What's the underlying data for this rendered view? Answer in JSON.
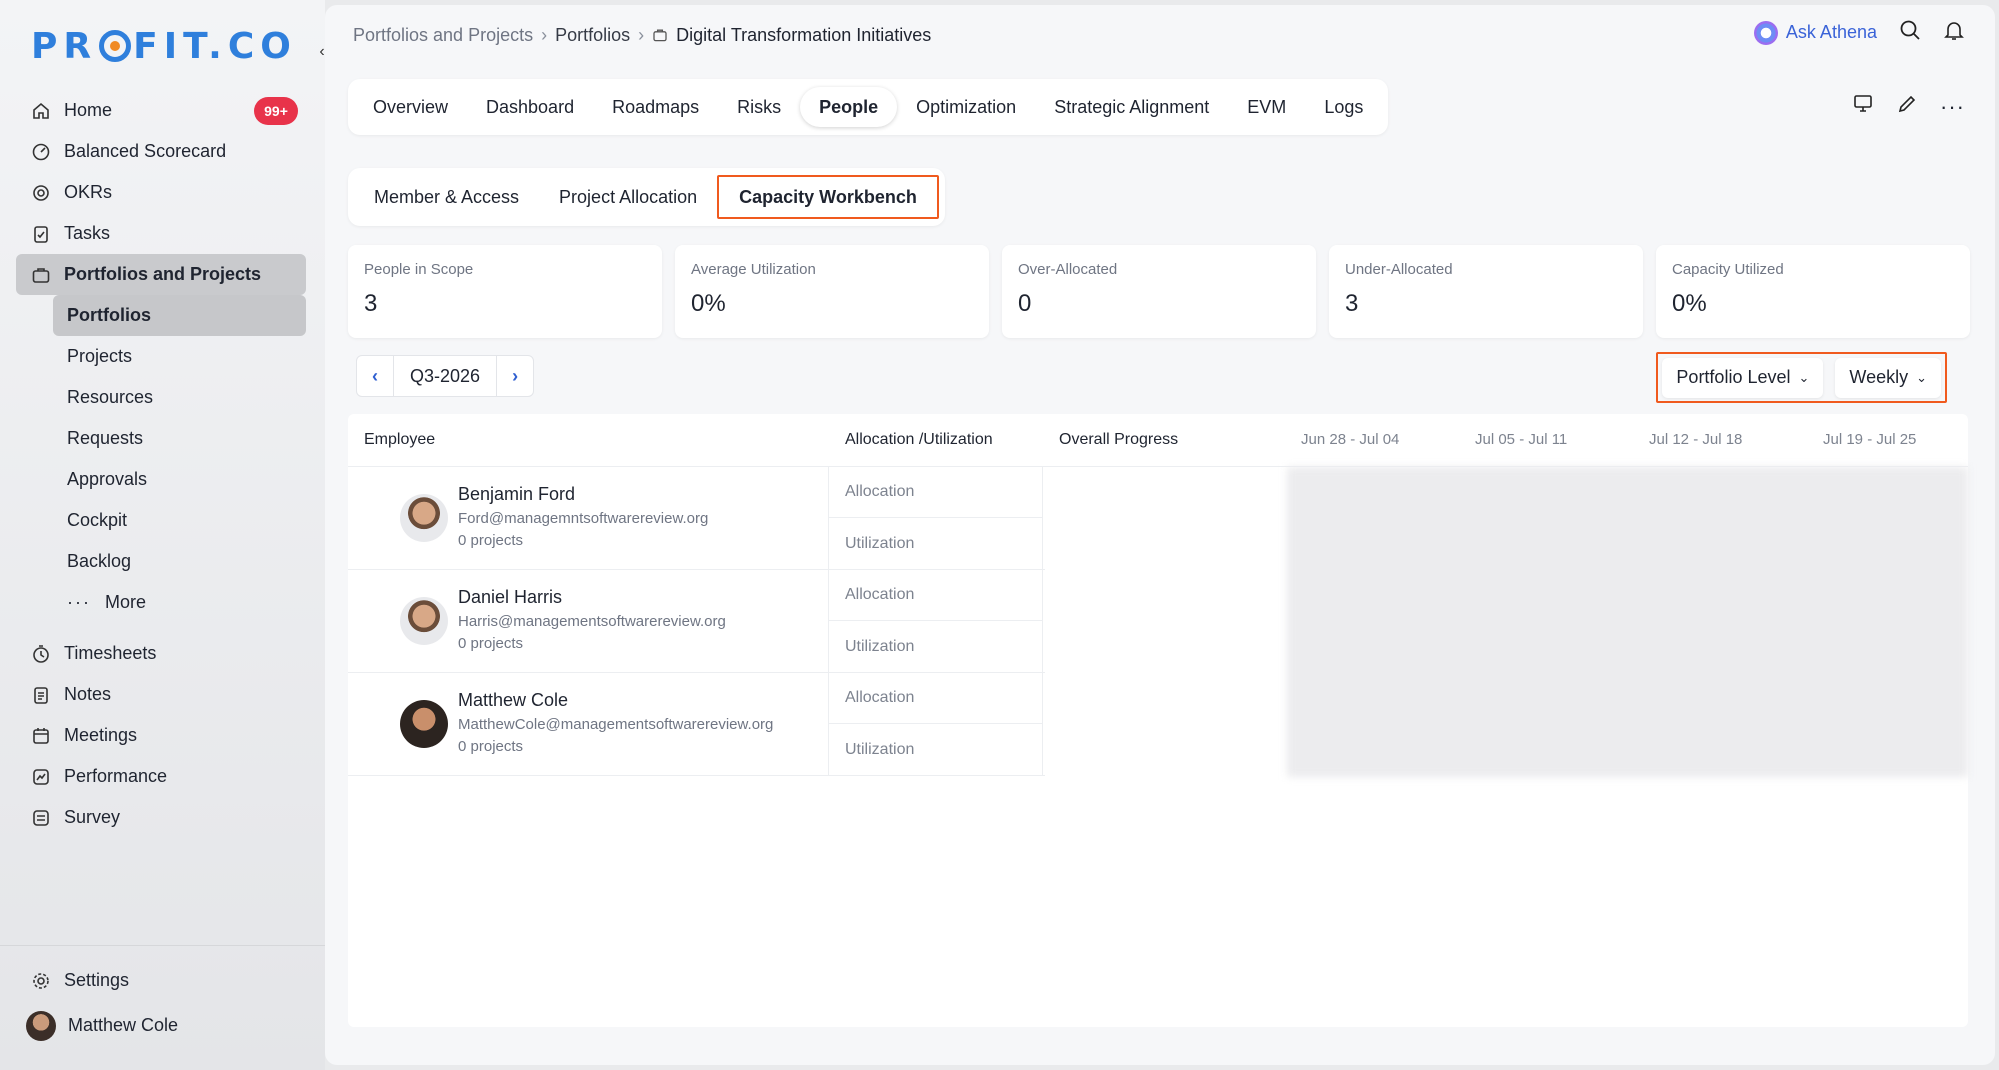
{
  "brand": {
    "logo_text_left": "PR",
    "logo_text_right": "FIT.CO"
  },
  "sidebar": {
    "items": [
      {
        "label": "Home",
        "badge": "99+"
      },
      {
        "label": "Balanced Scorecard"
      },
      {
        "label": "OKRs"
      },
      {
        "label": "Tasks"
      },
      {
        "label": "Portfolios and Projects"
      }
    ],
    "sub_items": [
      "Portfolios",
      "Projects",
      "Resources",
      "Requests",
      "Approvals",
      "Cockpit",
      "Backlog",
      "More"
    ],
    "items_lower": [
      "Timesheets",
      "Notes",
      "Meetings",
      "Performance",
      "Survey"
    ],
    "settings_label": "Settings",
    "user_name": "Matthew Cole"
  },
  "breadcrumb": {
    "level1": "Portfolios and Projects",
    "level2": "Portfolios",
    "current": "Digital Transformation Initiatives"
  },
  "header": {
    "ask_label": "Ask Athena"
  },
  "tabs": [
    "Overview",
    "Dashboard",
    "Roadmaps",
    "Risks",
    "People",
    "Optimization",
    "Strategic Alignment",
    "EVM",
    "Logs"
  ],
  "subtabs": [
    "Member & Access",
    "Project Allocation",
    "Capacity Workbench"
  ],
  "kpis": [
    {
      "label": "People in Scope",
      "value": "3"
    },
    {
      "label": "Average Utilization",
      "value": "0%"
    },
    {
      "label": "Over-Allocated",
      "value": "0"
    },
    {
      "label": "Under-Allocated",
      "value": "3"
    },
    {
      "label": "Capacity Utilized",
      "value": "0%"
    }
  ],
  "period": {
    "label": "Q3-2026"
  },
  "filters": {
    "level": "Portfolio Level",
    "granularity": "Weekly"
  },
  "grid": {
    "headers": {
      "employee": "Employee",
      "alloc_util": "Allocation /Utilization",
      "progress": "Overall Progress",
      "weeks": [
        "Jun 28 - Jul 04",
        "Jul 05 - Jul 11",
        "Jul 12 - Jul 18",
        "Jul 19 - Jul 25"
      ]
    },
    "row_labels": {
      "allocation": "Allocation",
      "utilization": "Utilization"
    },
    "employees": [
      {
        "name": "Benjamin Ford",
        "email": "Ford@managemntsoftwarereview.org",
        "projects": "0 projects"
      },
      {
        "name": "Daniel Harris",
        "email": "Harris@managementsoftwarereview.org",
        "projects": "0 projects"
      },
      {
        "name": "Matthew Cole",
        "email": "MatthewCole@managementsoftwarereview.org",
        "projects": "0 projects"
      }
    ]
  },
  "colors": {
    "accent": "#2f7fdc",
    "highlight": "#f05a1e",
    "badge": "#e8334a"
  }
}
